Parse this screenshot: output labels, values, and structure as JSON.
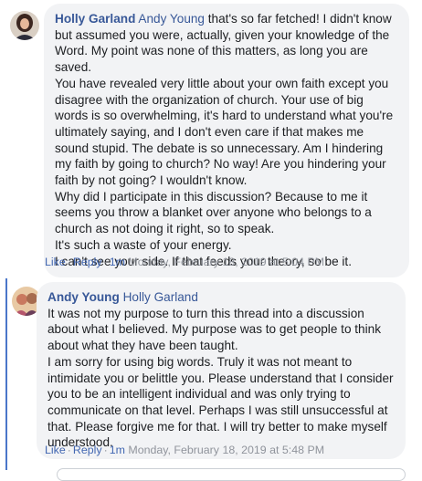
{
  "comments": [
    {
      "author": "Holly Garland",
      "tag": "Andy Young",
      "first_line": " that's so far fetched! I didn't know but assumed you were, actually, given your knowledge of the Word. My point was none of this matters, as long you are saved.",
      "paragraphs": [
        "You have revealed very little about your own faith except you disagree with the organization of church. Your use of big words is so overwhelming, it's hard to understand what you're ultimately saying, and I don't even care if that makes me sound stupid. The debate is so unnecessary. Am I hindering my faith by going to church? No way! Are you hindering your faith by not going? I wouldn't know.",
        "Why did I participate in this discussion? Because to me it seems you throw a blanket over anyone who belongs to a church as not doing it right, so to speak.",
        "It's such a waste of your energy.",
        "I can't see your side. If that feeds your theory, so be it."
      ],
      "like_label": "Like",
      "reply_label": "Reply",
      "age": "1m",
      "timestamp": "Monday, February 18, 2019 at 5:04 PM",
      "avatar_color": "#7a5044"
    },
    {
      "author": "Andy Young",
      "tag": "Holly Garland",
      "first_line": "",
      "paragraphs": [
        "It was not my purpose to turn this thread into a discussion about what I believed. My purpose was to get people to think about what they have been taught.",
        "I am sorry for using big words. Truly it was not meant to intimidate you or belittle you. Please understand that I consider you to be an intelligent individual and was only trying to communicate on that level. Perhaps I was still unsuccessful at that. Please forgive me for that. I will try better to make myself understood."
      ],
      "like_label": "Like",
      "reply_label": "Reply",
      "age": "1m",
      "timestamp": "Monday, February 18, 2019 at 5:48 PM",
      "avatar_color": "#b5556c"
    }
  ]
}
